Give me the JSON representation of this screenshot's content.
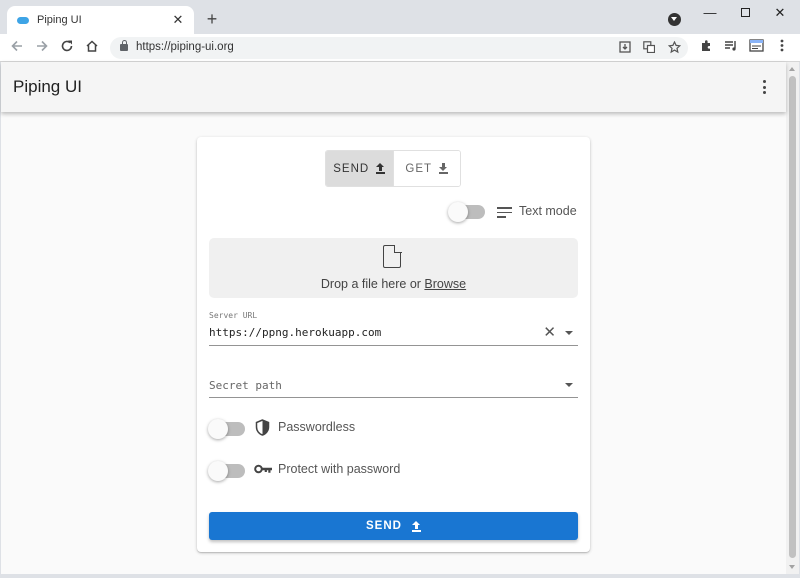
{
  "browser": {
    "tab_title": "Piping UI",
    "tab_close": "✕",
    "new_tab": "+",
    "url": "https://piping-ui.org",
    "window_minimize": "—",
    "window_close": "✕"
  },
  "app": {
    "title": "Piping UI"
  },
  "mode_toggle": {
    "send_label": "SEND",
    "get_label": "GET",
    "selected": "send"
  },
  "text_mode": {
    "label": "Text mode",
    "enabled": false
  },
  "dropzone": {
    "text": "Drop a file here or ",
    "browse_link": "Browse"
  },
  "server_url": {
    "label": "Server URL",
    "value": "https://ppng.herokuapp.com",
    "clear_glyph": "✕"
  },
  "secret_path": {
    "placeholder": "Secret path"
  },
  "options": {
    "passwordless_label": "Passwordless",
    "passwordless_enabled": false,
    "protect_label": "Protect with password",
    "protect_enabled": false
  },
  "send_button": {
    "label": "SEND"
  },
  "colors": {
    "primary": "#1976d2",
    "favicon": "#3ea4e6"
  },
  "icons": [
    "back-arrow-icon",
    "forward-arrow-icon",
    "reload-icon",
    "home-icon",
    "lock-icon",
    "install-icon",
    "translate-icon",
    "star-icon",
    "extensions-icon",
    "media-icon",
    "more-vert-icon",
    "upload-icon",
    "download-icon",
    "text-lines-icon",
    "file-icon",
    "close-icon",
    "dropdown-caret-icon",
    "shield-icon",
    "key-icon"
  ]
}
